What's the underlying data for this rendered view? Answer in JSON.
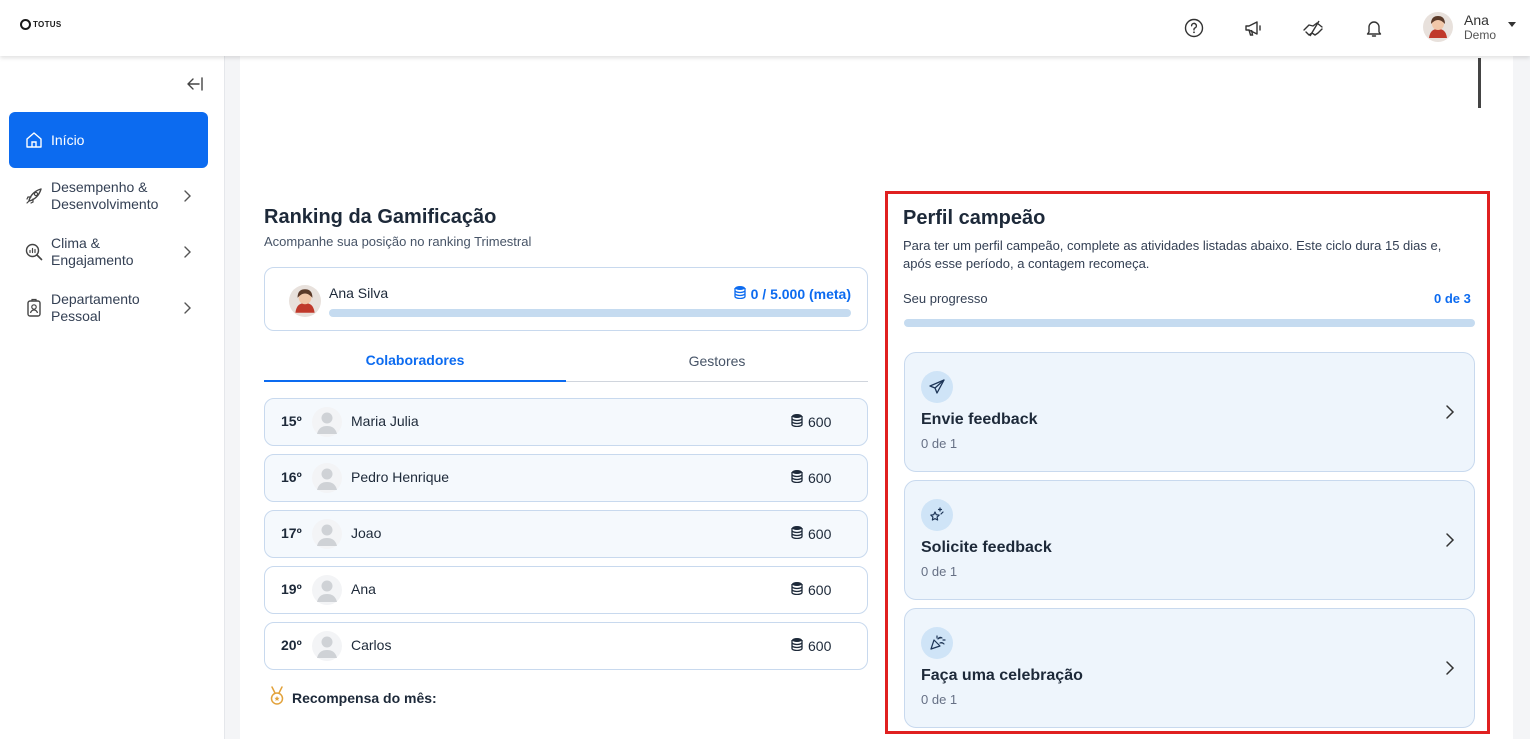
{
  "header": {
    "logo_text": "TOTUS",
    "user_name": "Ana",
    "user_role": "Demo"
  },
  "sidebar": {
    "items": [
      {
        "label": "Início",
        "icon": "home-icon",
        "active": true
      },
      {
        "label": "Desempenho & Desenvolvimento",
        "icon": "rocket-icon"
      },
      {
        "label": "Clima & Engajamento",
        "icon": "search-chart-icon"
      },
      {
        "label": "Departamento Pessoal",
        "icon": "badge-icon"
      }
    ]
  },
  "ranking": {
    "title": "Ranking da Gamificação",
    "subtitle": "Acompanhe sua posição no ranking Trimestral",
    "me": {
      "name": "Ana Silva",
      "points": "0 / 5.000 (meta)",
      "progress": 0
    },
    "tabs": [
      "Colaboradores",
      "Gestores"
    ],
    "rows": [
      {
        "pos": "15º",
        "name": "Maria Julia",
        "points": "600"
      },
      {
        "pos": "16º",
        "name": "Pedro Henrique",
        "points": "600"
      },
      {
        "pos": "17º",
        "name": "Joao",
        "points": "600"
      },
      {
        "pos": "19º",
        "name": "Ana",
        "points": "600"
      },
      {
        "pos": "20º",
        "name": "Carlos",
        "points": "600"
      }
    ],
    "reward_label": "Recompensa do mês:"
  },
  "perfil": {
    "title": "Perfil campeão",
    "description": "Para ter um perfil campeão, complete as atividades listadas abaixo. Este ciclo dura 15 dias e, após esse período, a contagem recomeça.",
    "progress_label": "Seu progresso",
    "progress_value": "0 de 3",
    "progress": 0,
    "tasks": [
      {
        "title": "Envie feedback",
        "count": "0 de 1",
        "icon": "paper-plane-icon"
      },
      {
        "title": "Solicite feedback",
        "count": "0 de 1",
        "icon": "sparkle-star-icon"
      },
      {
        "title": "Faça uma celebração",
        "count": "0 de 1",
        "icon": "party-popper-icon"
      }
    ]
  },
  "colors": {
    "accent": "#0c6bf0",
    "highlight_border": "#e02020"
  }
}
